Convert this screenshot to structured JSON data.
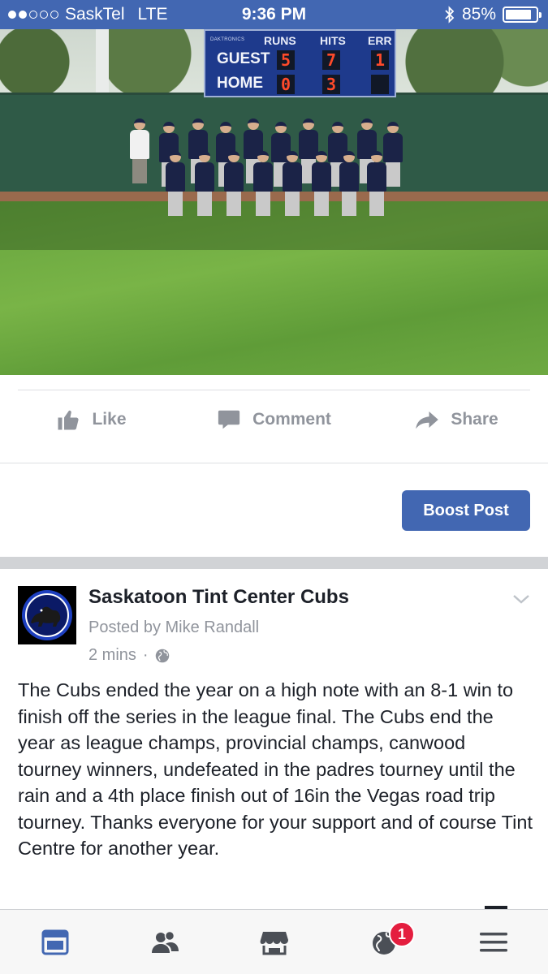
{
  "status_bar": {
    "carrier": "SaskTel",
    "network": "LTE",
    "time": "9:36 PM",
    "battery": "85%",
    "battery_level": 0.85,
    "signal_bars": 2
  },
  "photo": {
    "scoreboard": {
      "brand": "DAKTRONICS",
      "headers": [
        "RUNS",
        "HITS",
        "ERR"
      ],
      "rows": [
        {
          "label": "GUEST",
          "runs": "5",
          "hits": "7",
          "err": "1"
        },
        {
          "label": "HOME",
          "runs": "0",
          "hits": "3",
          "err": ""
        }
      ]
    }
  },
  "actions": {
    "like": "Like",
    "comment": "Comment",
    "share": "Share"
  },
  "boost_label": "Boost Post",
  "post": {
    "page_name": "Saskatoon Tint Center Cubs",
    "author": "Posted by Mike Randall",
    "time": "2 mins",
    "separator": "·",
    "text": "The Cubs ended the year on a high note with an 8-1 win to finish off the series in the league final. The Cubs end the year as league champs, provincial champs, canwood tourney winners, undefeated in the padres tourney until the rain and a 4th place finish out of 16in the Vegas road trip tourney. Thanks everyone for your support and of course Tint Centre for another year."
  },
  "tabs": [
    {
      "icon": "news-feed-icon",
      "active": true
    },
    {
      "icon": "friends-icon",
      "active": false
    },
    {
      "icon": "marketplace-icon",
      "active": false
    },
    {
      "icon": "globe-icon",
      "active": false,
      "badge": "1"
    },
    {
      "icon": "menu-icon",
      "active": false
    }
  ],
  "colors": {
    "brand": "#4267b2",
    "text_muted": "#90949c",
    "badge": "#e41e3f"
  }
}
